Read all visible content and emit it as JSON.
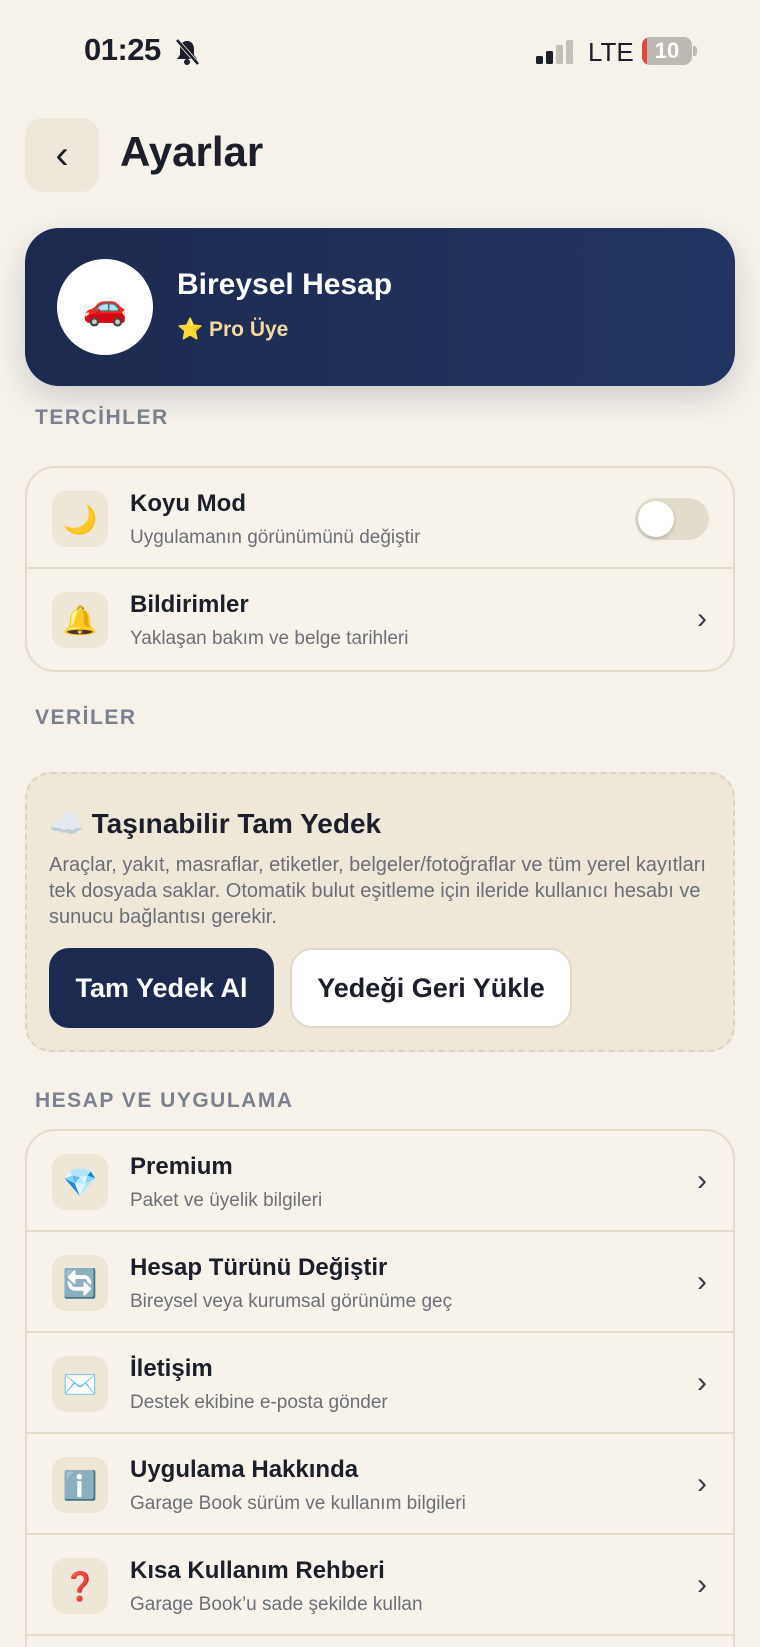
{
  "status_bar": {
    "time": "01:25",
    "network": "LTE",
    "battery": "10",
    "battery_level": 0.1,
    "colors": {
      "battery_low": "#e0473d"
    }
  },
  "header": {
    "title": "Ayarlar",
    "back_icon": "chevron-left-icon"
  },
  "profile": {
    "name": "Bireysel Hesap",
    "badge": "⭐ Pro Üye",
    "avatar_icon": "car-icon"
  },
  "preferences": {
    "header": "TERCİHLER",
    "items": [
      {
        "icon": "moon-icon",
        "glyph": "🌙",
        "title": "Koyu Mod",
        "subtitle": "Uygulamanın görünümünü değiştir",
        "toggle_on": false
      },
      {
        "icon": "bell-icon",
        "glyph": "🔔",
        "title": "Bildirimler",
        "subtitle": "Yaklaşan bakım ve belge tarihleri"
      }
    ]
  },
  "data_section": {
    "header": "VERİLER",
    "backup": {
      "title": "☁️ Taşınabilir Tam Yedek",
      "description": "Araçlar, yakıt, masraflar, etiketler, belgeler/fotoğraflar ve tüm yerel kayıtları tek dosyada saklar. Otomatik bulut eşitleme için ileride kullanıcı hesabı ve sunucu bağlantısı gerekir.",
      "backup_button": "Tam Yedek Al",
      "restore_button": "Yedeği Geri Yükle"
    }
  },
  "account": {
    "header": "HESAP VE UYGULAMA",
    "items": [
      {
        "icon": "diamond-icon",
        "glyph": "💎",
        "title": "Premium",
        "subtitle": "Paket ve üyelik bilgileri"
      },
      {
        "icon": "sync-icon",
        "glyph": "🔄",
        "title": "Hesap Türünü Değiştir",
        "subtitle": "Bireysel veya kurumsal görünüme geç"
      },
      {
        "icon": "envelope-icon",
        "glyph": "✉️",
        "title": "İletişim",
        "subtitle": "Destek ekibine e-posta gönder"
      },
      {
        "icon": "info-icon",
        "glyph": "ℹ️",
        "title": "Uygulama Hakkında",
        "subtitle": "Garage Book sürüm ve kullanım bilgileri"
      },
      {
        "icon": "question-icon",
        "glyph": "❓",
        "title": "Kısa Kullanım Rehberi",
        "subtitle": "Garage Book’u sade şekilde kullan"
      }
    ]
  }
}
